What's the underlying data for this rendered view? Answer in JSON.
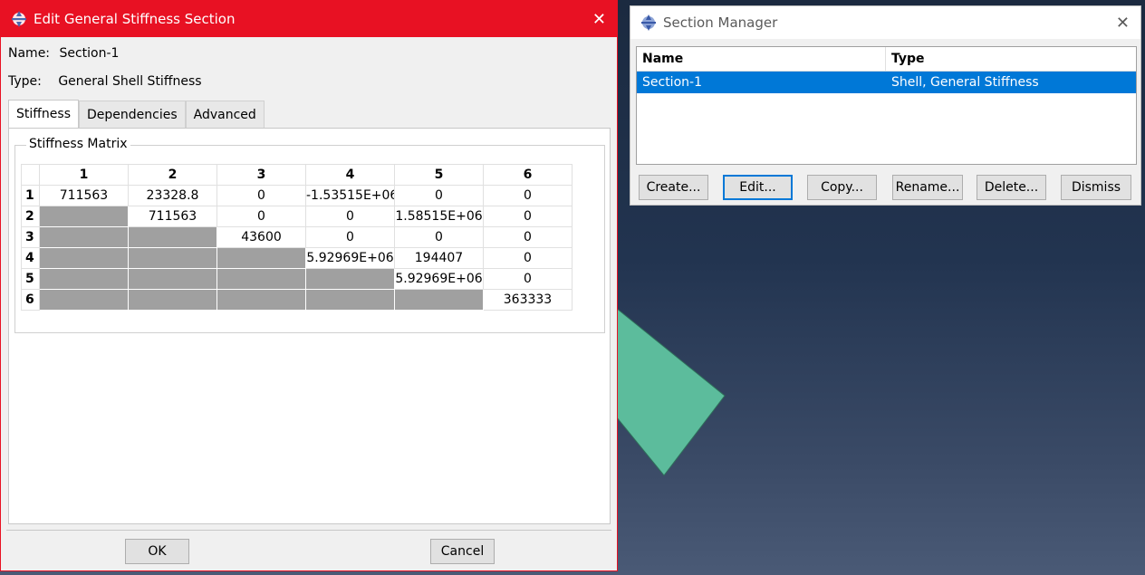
{
  "edit_dialog": {
    "title": "Edit General Stiffness Section",
    "name_label": "Name:",
    "name_value": "Section-1",
    "type_label": "Type:",
    "type_value": "General Shell Stiffness",
    "tabs": [
      {
        "label": "Stiffness",
        "active": true
      },
      {
        "label": "Dependencies",
        "active": false
      },
      {
        "label": "Advanced",
        "active": false
      }
    ],
    "group_title": "Stiffness Matrix",
    "column_headers": [
      "1",
      "2",
      "3",
      "4",
      "5",
      "6"
    ],
    "rows": [
      {
        "header": "1",
        "cells": [
          "711563",
          "23328.8",
          "0",
          "-1.53515E+06",
          "0",
          "0"
        ]
      },
      {
        "header": "2",
        "cells": [
          null,
          "711563",
          "0",
          "0",
          "1.58515E+06",
          "0"
        ]
      },
      {
        "header": "3",
        "cells": [
          null,
          null,
          "43600",
          "0",
          "0",
          "0"
        ]
      },
      {
        "header": "4",
        "cells": [
          null,
          null,
          null,
          "5.92969E+06",
          "194407",
          "0"
        ]
      },
      {
        "header": "5",
        "cells": [
          null,
          null,
          null,
          null,
          "5.92969E+06",
          "0"
        ]
      },
      {
        "header": "6",
        "cells": [
          null,
          null,
          null,
          null,
          null,
          "363333"
        ]
      }
    ],
    "ok_label": "OK",
    "cancel_label": "Cancel",
    "titlebar_color": "#e81123"
  },
  "section_manager": {
    "title": "Section Manager",
    "columns": {
      "name": "Name",
      "type": "Type"
    },
    "rows": [
      {
        "name": "Section-1",
        "type": "Shell, General Stiffness",
        "selected": true
      }
    ],
    "buttons": {
      "create": "Create...",
      "edit": "Edit...",
      "copy": "Copy...",
      "rename": "Rename...",
      "delete": "Delete...",
      "dismiss": "Dismiss"
    },
    "selection_color": "#0078d7"
  },
  "viewport": {
    "shape_color": "#5cbc9c"
  }
}
